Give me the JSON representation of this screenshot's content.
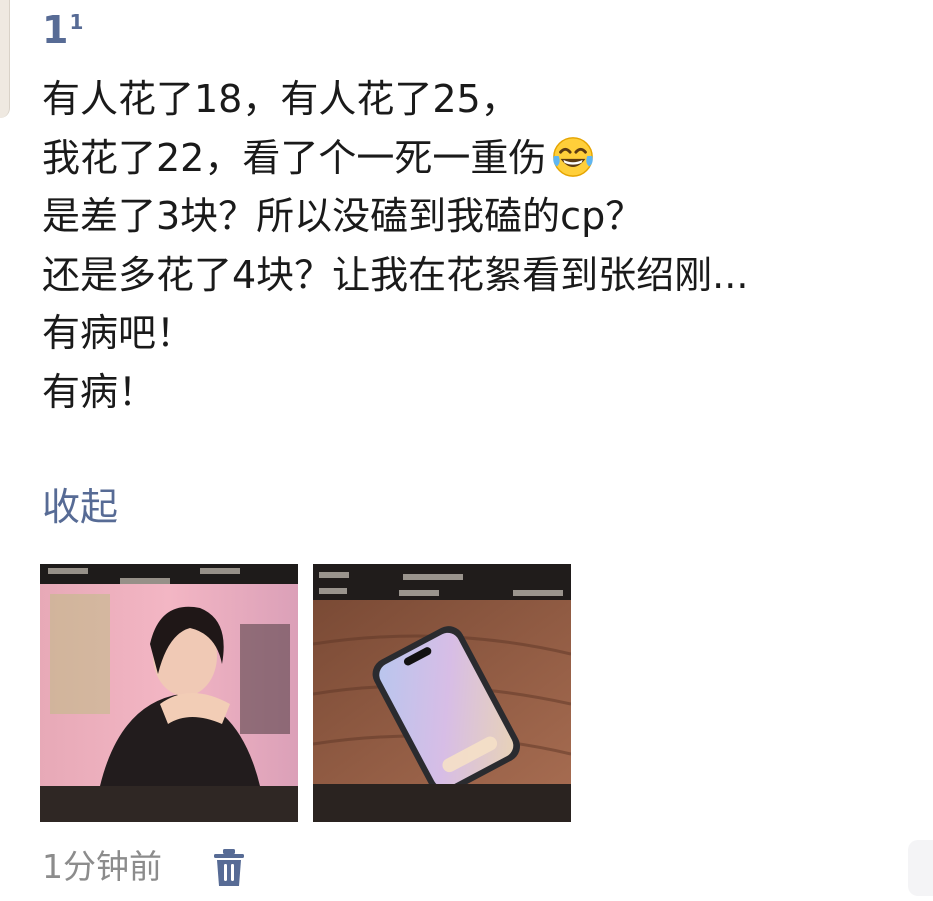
{
  "post": {
    "username": "1",
    "username_superscript": "1",
    "lines": [
      "有人花了18，有人花了25，",
      "我花了22，看了个一死一重伤",
      "是差了3块？所以没磕到我磕的cp？",
      "还是多花了4块？让我在花絮看到张绍刚...",
      "有病吧！",
      "有病！"
    ],
    "emoji_after_line2": "tears-of-joy-emoji",
    "collapse_label": "收起",
    "photos": [
      {
        "description_icon": "photo-woman-crying"
      },
      {
        "description_icon": "photo-phone-on-table"
      }
    ],
    "timestamp": "1分钟前",
    "delete_icon": "trash-icon"
  },
  "colors": {
    "link": "#576b95",
    "text": "#1a1a1a",
    "muted": "#8c8c8c"
  }
}
